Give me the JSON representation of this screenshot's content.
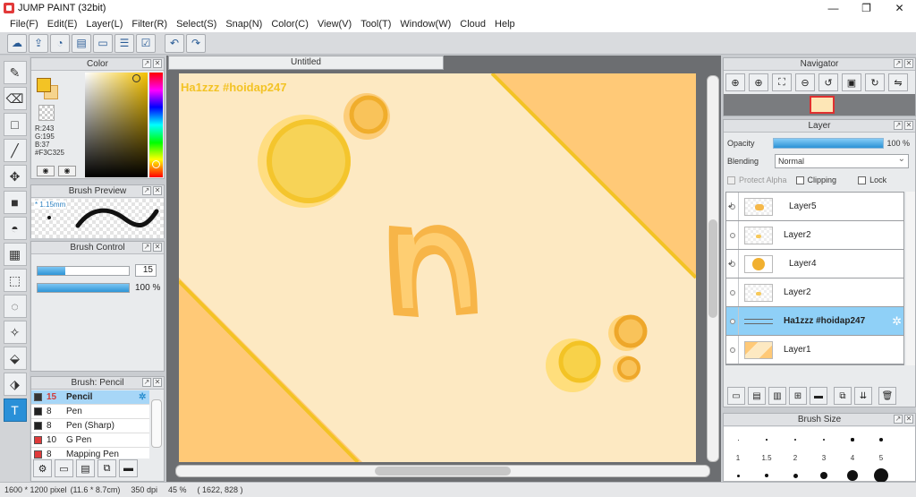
{
  "window": {
    "title": "JUMP PAINT (32bit)",
    "minimize": "—",
    "maximize": "❐",
    "close": "✕"
  },
  "menu": [
    "File(F)",
    "Edit(E)",
    "Layer(L)",
    "Filter(R)",
    "Select(S)",
    "Snap(N)",
    "Color(C)",
    "View(V)",
    "Tool(T)",
    "Window(W)",
    "Cloud",
    "Help"
  ],
  "toolbar_icons": [
    "cloud-icon",
    "share-icon",
    "comment-icon",
    "chat-icon",
    "page-icon",
    "list-icon",
    "checklist-icon",
    "undo-icon",
    "redo-icon"
  ],
  "tools": [
    "brush-icon",
    "eraser-icon",
    "rectangle-icon",
    "pen-line-icon",
    "move-icon",
    "fill-rect-icon",
    "bucket-icon",
    "gradient-icon",
    "marquee-icon",
    "lasso-icon",
    "magic-wand-icon",
    "select-pen-icon",
    "select-eraser-icon",
    "text-icon"
  ],
  "color_panel": {
    "title": "Color",
    "fg_color": "#F3C325",
    "rgb_r": "R:243",
    "rgb_g": "G:195",
    "rgb_b": "B:37",
    "hex": "#F3C325"
  },
  "brush_preview": {
    "title": "Brush Preview",
    "size_label": "* 1.15mm"
  },
  "brush_control": {
    "title": "Brush Control",
    "size_value": "15",
    "size_fraction": 0.3,
    "opacity_value": "100 %",
    "opacity_fraction": 1.0
  },
  "brush_list": {
    "title": "Brush: Pencil",
    "items": [
      {
        "num": "15",
        "name": "Pencil",
        "color": "#333333",
        "selected": true
      },
      {
        "num": "8",
        "name": "Pen",
        "color": "#222222",
        "selected": false
      },
      {
        "num": "8",
        "name": "Pen (Sharp)",
        "color": "#222222",
        "selected": false
      },
      {
        "num": "10",
        "name": "G Pen",
        "color": "#e03a3a",
        "selected": false
      },
      {
        "num": "8",
        "name": "Mapping Pen",
        "color": "#e03a3a",
        "selected": false
      }
    ]
  },
  "document": {
    "tab_title": "Untitled",
    "watermark": "Ha1zzz #hoidap247"
  },
  "navigator": {
    "title": "Navigator"
  },
  "layer_panel": {
    "title": "Layer",
    "opacity_label": "Opacity",
    "opacity_value": "100 %",
    "blending_label": "Blending",
    "blending_value": "Normal",
    "protect_alpha": "Protect Alpha",
    "clipping": "Clipping",
    "lock": "Lock",
    "layers": [
      {
        "name": "Layer5",
        "clip": true,
        "selected": false
      },
      {
        "name": "Layer2",
        "clip": false,
        "selected": false
      },
      {
        "name": "Layer4",
        "clip": true,
        "selected": false
      },
      {
        "name": "Layer2",
        "clip": false,
        "selected": false
      },
      {
        "name": "Ha1zzz #hoidap247",
        "clip": false,
        "selected": true
      },
      {
        "name": "Layer1",
        "clip": false,
        "selected": false
      }
    ]
  },
  "brush_size": {
    "title": "Brush Size",
    "labels": [
      "1",
      "1.5",
      "2",
      "3",
      "4",
      "5"
    ]
  },
  "status": {
    "pixels": "1600 * 1200 pixel",
    "cm": "(11.6 * 8.7cm)",
    "dpi": "350 dpi",
    "zoom": "45 %",
    "coords": "( 1622, 828 )"
  }
}
